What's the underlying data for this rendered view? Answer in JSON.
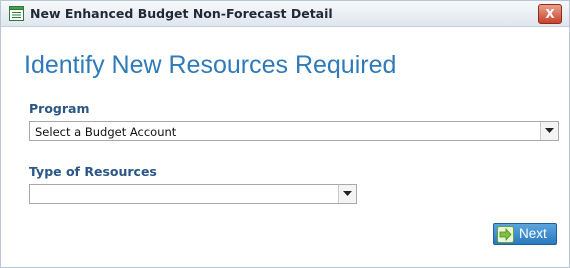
{
  "window": {
    "title": "New Enhanced Budget Non-Forecast Detail",
    "close_label": "X",
    "title_icon": "form-icon"
  },
  "main": {
    "heading": "Identify New Resources Required"
  },
  "program": {
    "label": "Program",
    "selected": "Select a Budget Account"
  },
  "types": {
    "label": "Type of Resources",
    "selected": ""
  },
  "actions": {
    "next_label": "Next",
    "next_icon": "arrow-right-icon"
  },
  "colors": {
    "heading": "#2f7ab9",
    "label": "#2a5785",
    "button": "#2a78bf",
    "arrow": "#7cc23b"
  }
}
